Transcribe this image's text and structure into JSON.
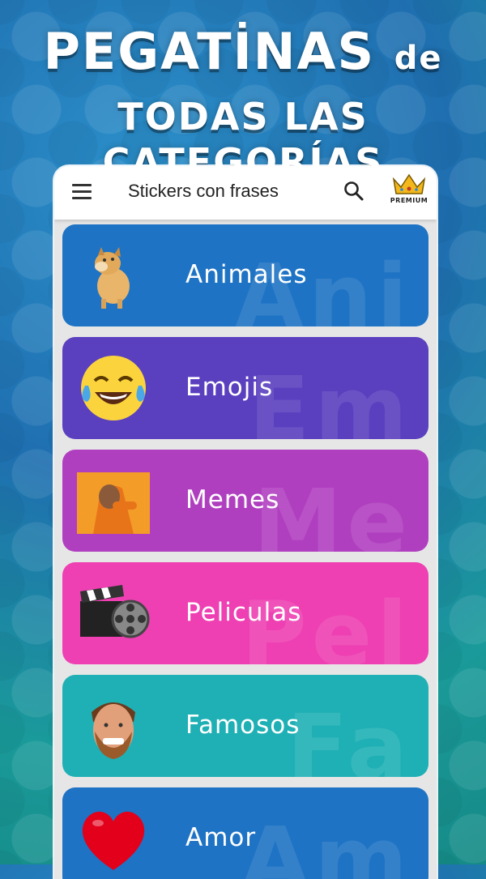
{
  "headline": {
    "line1_main": "PEGATİNAS",
    "line1_suffix": "de",
    "line2": "TODAS LAS CATEGORÍAS"
  },
  "appbar": {
    "title": "Stickers con frases",
    "premium_label": "PREMIUM"
  },
  "categories": [
    {
      "label": "Animales",
      "ghost": "Ani",
      "color": "#1e73c4",
      "icon": "dog-icon"
    },
    {
      "label": "Emojis",
      "ghost": "Em",
      "color": "#5a3fbf",
      "icon": "laughing-emoji-icon"
    },
    {
      "label": "Memes",
      "ghost": "Me",
      "color": "#b03fc0",
      "icon": "meme-icon"
    },
    {
      "label": "Peliculas",
      "ghost": "Pel",
      "color": "#ee40b2",
      "icon": "clapperboard-icon"
    },
    {
      "label": "Famosos",
      "ghost": "Fa",
      "color": "#1fb0b5",
      "icon": "celebrity-face-icon"
    },
    {
      "label": "Amor",
      "ghost": "Am",
      "color": "#1e73c4",
      "icon": "heart-icon"
    }
  ]
}
